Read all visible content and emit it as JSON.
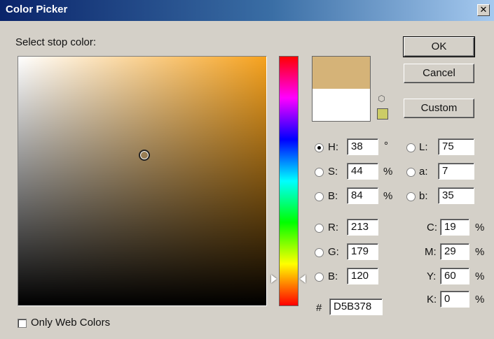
{
  "window": {
    "title": "Color Picker",
    "close_glyph": "✕"
  },
  "prompt": "Select stop color:",
  "swatches": {
    "new_color": "#d5b378",
    "old_color": "#ffffff",
    "websafe_color": "#cccc66"
  },
  "buttons": {
    "ok": "OK",
    "cancel": "Cancel",
    "custom": "Custom"
  },
  "hsb": {
    "h": {
      "label": "H:",
      "value": "38",
      "unit": "°"
    },
    "s": {
      "label": "S:",
      "value": "44",
      "unit": "%"
    },
    "b": {
      "label": "B:",
      "value": "84",
      "unit": "%"
    }
  },
  "lab": {
    "l": {
      "label": "L:",
      "value": "75"
    },
    "a": {
      "label": "a:",
      "value": "7"
    },
    "b": {
      "label": "b:",
      "value": "35"
    }
  },
  "rgb": {
    "r": {
      "label": "R:",
      "value": "213"
    },
    "g": {
      "label": "G:",
      "value": "179"
    },
    "b": {
      "label": "B:",
      "value": "120"
    }
  },
  "cmyk": {
    "c": {
      "label": "C:",
      "value": "19",
      "unit": "%"
    },
    "m": {
      "label": "M:",
      "value": "29",
      "unit": "%"
    },
    "y": {
      "label": "Y:",
      "value": "60",
      "unit": "%"
    },
    "k": {
      "label": "K:",
      "value": "0",
      "unit": "%"
    }
  },
  "hex": {
    "label": "#",
    "value": "D5B378"
  },
  "web_colors": {
    "label": "Only Web Colors",
    "checked": false
  },
  "icons": {
    "gamut_warning": "cube-warning-icon"
  }
}
